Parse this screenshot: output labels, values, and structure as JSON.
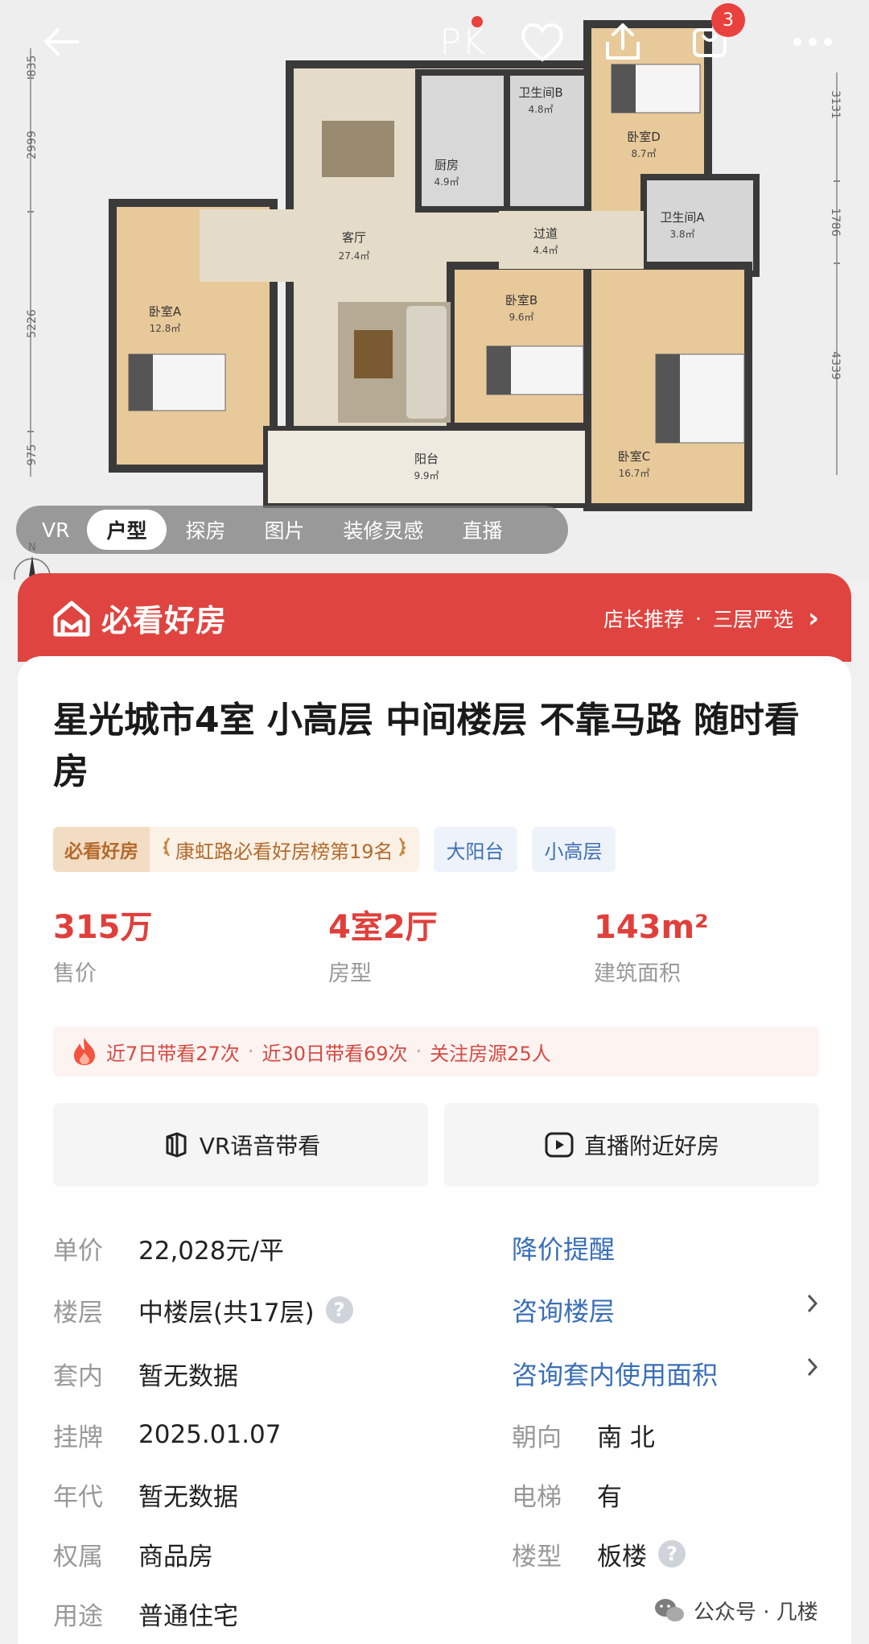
{
  "header": {
    "pk_label": "PK",
    "cart_count": "3"
  },
  "floorplan": {
    "left_dims": [
      "835",
      "2999",
      "5226",
      "975"
    ],
    "right_dims": [
      "3131",
      "1786",
      "4339"
    ],
    "rooms": [
      {
        "name": "卫生间B",
        "area": "4.8㎡"
      },
      {
        "name": "卧室D",
        "area": "8.7㎡"
      },
      {
        "name": "厨房",
        "area": "4.9㎡"
      },
      {
        "name": "卫生间A",
        "area": "3.8㎡"
      },
      {
        "name": "客厅",
        "area": "27.4㎡"
      },
      {
        "name": "过道",
        "area": "4.4㎡"
      },
      {
        "name": "卧室A",
        "area": "12.8㎡"
      },
      {
        "name": "卧室B",
        "area": "9.6㎡"
      },
      {
        "name": "阳台",
        "area": "9.9㎡"
      },
      {
        "name": "卧室C",
        "area": "16.7㎡"
      }
    ],
    "compass": "N"
  },
  "media_tabs": [
    "VR",
    "户型",
    "探房",
    "图片",
    "装修灵感",
    "直播"
  ],
  "banner": {
    "title": "必看好房",
    "right_a": "店长推荐",
    "dot": "·",
    "right_b": "三层严选",
    "chevron": "›"
  },
  "listing": {
    "title": "星光城市4室 小高层 中间楼层 不靠马路 随时看房",
    "tag_main_left": "必看好房",
    "tag_main_right": "康虹路必看好房榜第19名",
    "tag_1": "大阳台",
    "tag_2": "小高层"
  },
  "stats": {
    "price_value": "315万",
    "price_label": "售价",
    "layout_value": "4室2厅",
    "layout_label": "房型",
    "area_value": "143m²",
    "area_label": "建筑面积"
  },
  "heat": {
    "a": "近7日带看27次",
    "b": "近30日带看69次",
    "c": "关注房源25人",
    "sep": "·"
  },
  "actions": {
    "vr": "VR语音带看",
    "live": "直播附近好房"
  },
  "info": {
    "unit_price_key": "单价",
    "unit_price_val": "22,028元/平",
    "price_alert": "降价提醒",
    "floor_key": "楼层",
    "floor_val": "中楼层(共17层)",
    "floor_link": "咨询楼层",
    "inner_key": "套内",
    "inner_val": "暂无数据",
    "inner_link": "咨询套内使用面积",
    "listed_key": "挂牌",
    "listed_val": "2025.01.07",
    "orient_key": "朝向",
    "orient_val": "南 北",
    "year_key": "年代",
    "year_val": "暂无数据",
    "elevator_key": "电梯",
    "elevator_val": "有",
    "ownership_key": "权属",
    "ownership_val": "商品房",
    "building_key": "楼型",
    "building_val": "板楼",
    "usage_key": "用途",
    "usage_val": "普通住宅",
    "help": "?"
  },
  "watermark": {
    "text": "公众号 · 几楼"
  }
}
